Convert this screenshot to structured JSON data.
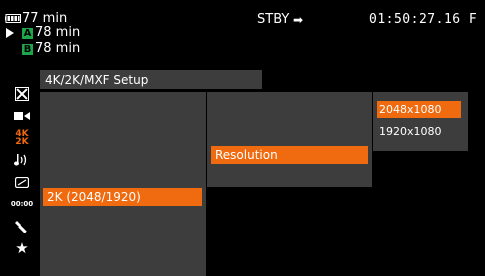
{
  "status": {
    "battery_minutes": "77 min",
    "slot_a_label": "A",
    "slot_a_minutes": "78 min",
    "slot_b_label": "B",
    "slot_b_minutes": "78 min",
    "mode": "STBY",
    "timecode": "01:50:27.16 F"
  },
  "sidebar": {
    "icons": [
      "close-icon",
      "camera-icon",
      "4k-2k-icon",
      "audio-icon",
      "display-icon",
      "timecode-icon",
      "wrench-icon",
      "star-icon"
    ],
    "labels": [
      "4K",
      "2K",
      "00:00"
    ]
  },
  "menu": {
    "title": "4K/2K/MXF Setup",
    "level1_selected": "2K (2048/1920)",
    "level2_selected": "Resolution",
    "level3_options": [
      "2048x1080",
      "1920x1080"
    ],
    "level3_selected": "2048x1080"
  },
  "colors": {
    "accent": "#f06a0f",
    "panel": "#3d3d3d",
    "slot_badge": "#1ea64a"
  }
}
